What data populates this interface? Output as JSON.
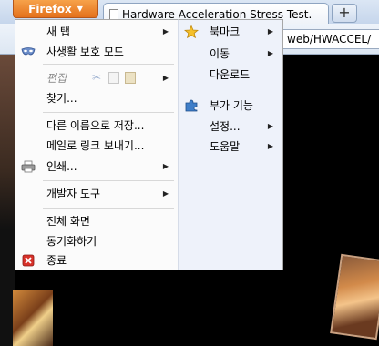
{
  "browser": {
    "app_button_label": "Firefox",
    "tab_title": "Hardware Acceleration Stress Test.",
    "new_tab_label": "+",
    "url_fragment": "web/HWACCEL/"
  },
  "main_menu": {
    "items": [
      {
        "label": "새 탭",
        "has_submenu": true
      },
      {
        "label": "사생활 보호 모드",
        "icon": "mask-icon"
      },
      {
        "label": "편집",
        "disabled": true,
        "has_submenu": true
      },
      {
        "label": "찾기..."
      },
      {
        "label": "다른 이름으로 저장..."
      },
      {
        "label": "메일로 링크 보내기..."
      },
      {
        "label": "인쇄...",
        "icon": "printer-icon",
        "has_submenu": true
      },
      {
        "label": "개발자 도구",
        "has_submenu": true
      },
      {
        "label": "전체 화면"
      },
      {
        "label": "동기화하기"
      },
      {
        "label": "종료",
        "icon": "exit-icon"
      }
    ]
  },
  "sub_menu": {
    "items": [
      {
        "label": "북마크",
        "icon": "star-icon",
        "has_submenu": true
      },
      {
        "label": "이동",
        "has_submenu": true
      },
      {
        "label": "다운로드"
      },
      {
        "label": "부가 기능",
        "icon": "puzzle-icon"
      },
      {
        "label": "설정...",
        "has_submenu": true
      },
      {
        "label": "도움말",
        "has_submenu": true
      }
    ]
  },
  "colors": {
    "firefox_button": "#e4711c",
    "menu_background": "#fbfbfb",
    "submenu_background": "#eef2fa",
    "page_background": "#000000"
  }
}
